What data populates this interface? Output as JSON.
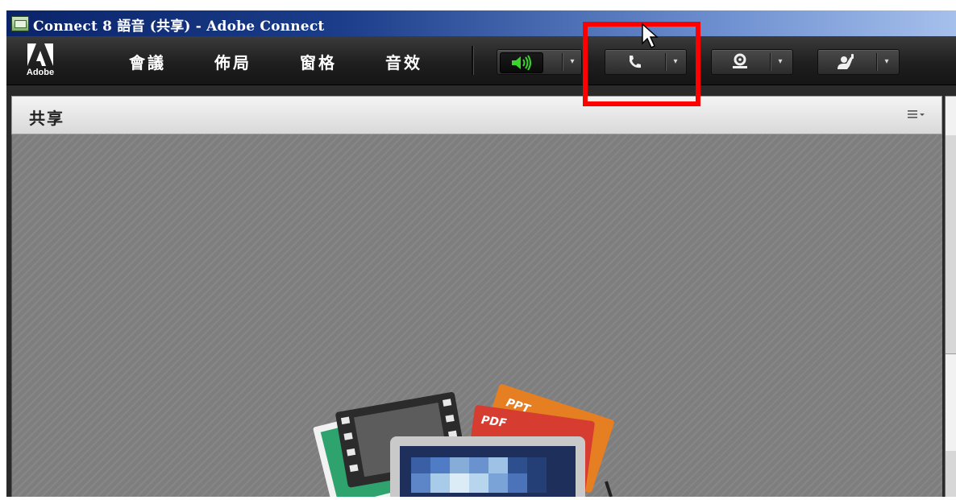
{
  "window": {
    "title": "Connect 8 語音 (共享) - Adobe Connect"
  },
  "toolbar": {
    "logo_text": "Adobe",
    "menu": [
      {
        "label": "會議"
      },
      {
        "label": "佈局"
      },
      {
        "label": "窗格"
      },
      {
        "label": "音效"
      }
    ],
    "buttons": [
      {
        "name": "speaker",
        "icon": "speaker-icon",
        "active": true,
        "accent": "#39d62a"
      },
      {
        "name": "phone",
        "icon": "phone-icon",
        "highlighted": true
      },
      {
        "name": "webcam",
        "icon": "webcam-icon"
      },
      {
        "name": "raise-hand",
        "icon": "raise-hand-icon"
      }
    ],
    "dropdown_glyph": "▾"
  },
  "pod": {
    "title": "共享",
    "menu_icon": "pod-options-icon",
    "illustration": {
      "labels": [
        "PPT",
        "PDF"
      ]
    }
  },
  "colors": {
    "highlight_box": "#ff0000",
    "titlebar": "#0a246a",
    "speaker_active": "#39d62a",
    "ppt": "#e67e22",
    "pdf": "#d63c2f"
  }
}
